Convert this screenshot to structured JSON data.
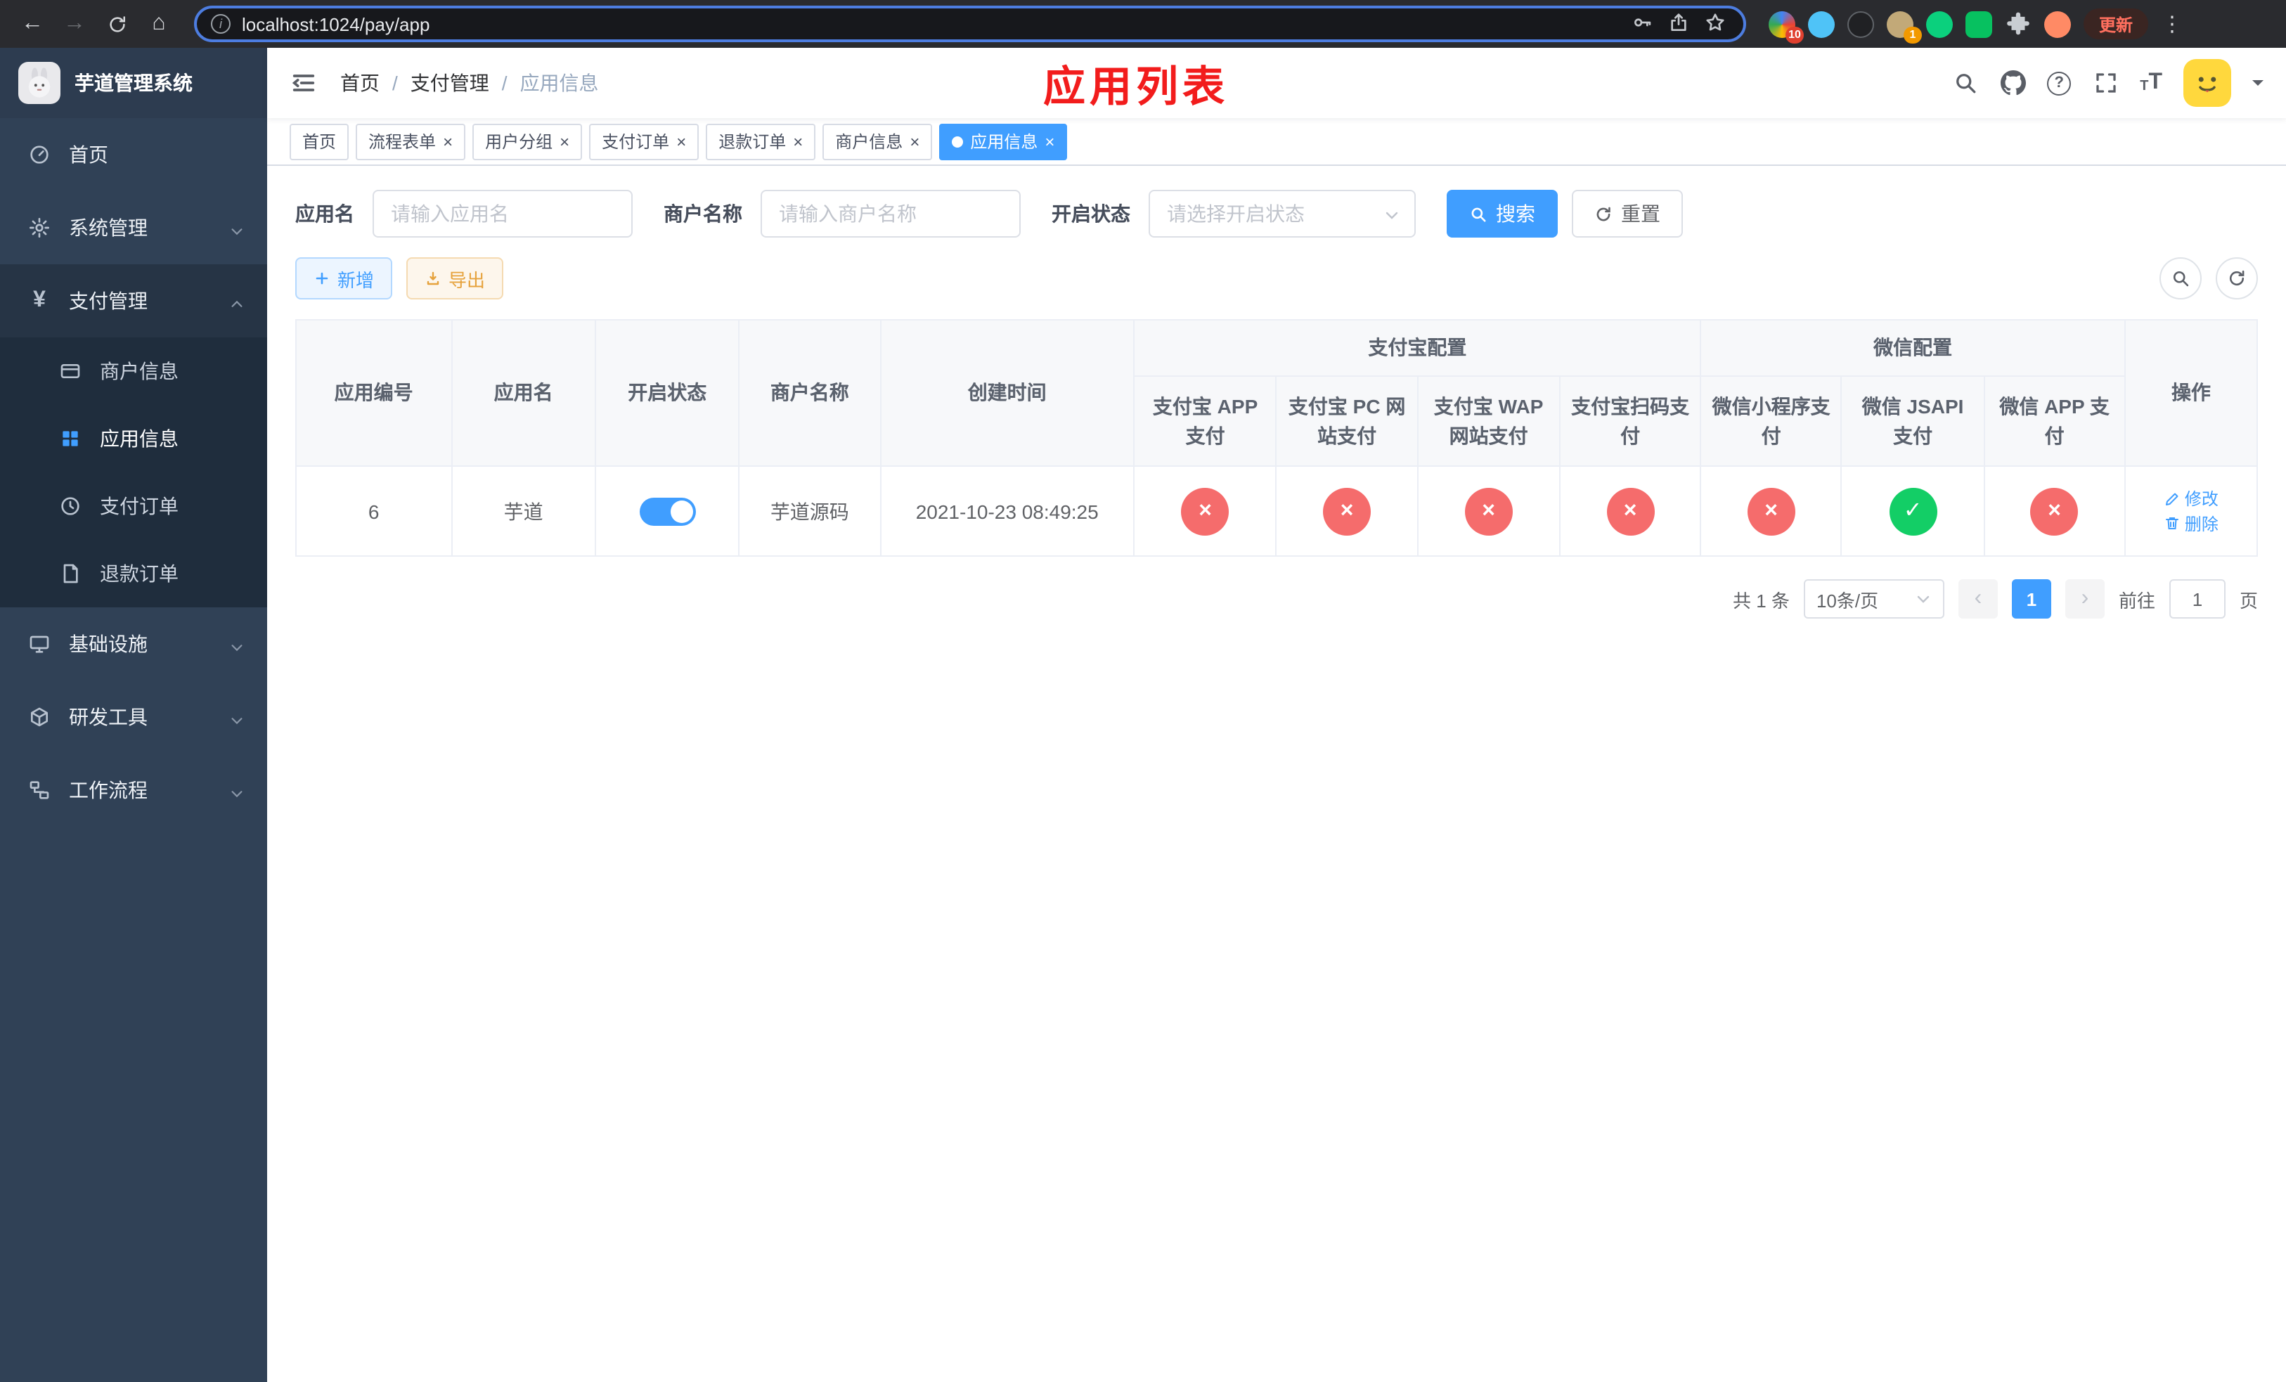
{
  "colors": {
    "accent": "#409eff",
    "success": "#13ce66",
    "danger": "#f56c6c",
    "warning": "#e6a23c",
    "annotation": "#f21c1c"
  },
  "ui": {
    "close_glyph": "×",
    "check_glyph": "✓",
    "cross_glyph": "×"
  },
  "browser": {
    "url": "localhost:1024/pay/app",
    "update_label": "更新",
    "ext_badge_puzzle": "10",
    "ext_badge_profile": "1"
  },
  "sidebar": {
    "logo_title": "芋道管理系统",
    "items": [
      {
        "label": "首页"
      },
      {
        "label": "系统管理"
      },
      {
        "label": "支付管理",
        "children": [
          {
            "label": "商户信息"
          },
          {
            "label": "应用信息"
          },
          {
            "label": "支付订单"
          },
          {
            "label": "退款订单"
          }
        ]
      },
      {
        "label": "基础设施"
      },
      {
        "label": "研发工具"
      },
      {
        "label": "工作流程"
      }
    ]
  },
  "navbar": {
    "breadcrumb": [
      "首页",
      "支付管理",
      "应用信息"
    ],
    "separator": "/",
    "annotation": "应用列表"
  },
  "tabs": [
    {
      "label": "首页"
    },
    {
      "label": "流程表单"
    },
    {
      "label": "用户分组"
    },
    {
      "label": "支付订单"
    },
    {
      "label": "退款订单"
    },
    {
      "label": "商户信息"
    },
    {
      "label": "应用信息"
    }
  ],
  "filters": {
    "app_name_label": "应用名",
    "app_name_placeholder": "请输入应用名",
    "merchant_label": "商户名称",
    "merchant_placeholder": "请输入商户名称",
    "status_label": "开启状态",
    "status_placeholder": "请选择开启状态",
    "search_label": "搜索",
    "reset_label": "重置"
  },
  "toolbar": {
    "add_label": "新增",
    "export_label": "导出"
  },
  "table": {
    "group_alipay": "支付宝配置",
    "group_wechat": "微信配置",
    "columns": [
      "应用编号",
      "应用名",
      "开启状态",
      "商户名称",
      "创建时间",
      "支付宝 APP 支付",
      "支付宝 PC 网站支付",
      "支付宝 WAP 网站支付",
      "支付宝扫码支付",
      "微信小程序支付",
      "微信 JSAPI 支付",
      "微信 APP 支付",
      "操作"
    ],
    "rows": [
      {
        "app_id": "6",
        "app_name": "芋道",
        "enabled": true,
        "merchant_name": "芋道源码",
        "create_time": "2021-10-23 08:49:25",
        "statuses": [
          false,
          false,
          false,
          false,
          false,
          true,
          false
        ],
        "edit_label": "修改",
        "delete_label": "删除"
      }
    ]
  },
  "pagination": {
    "total_text": "共 1 条",
    "page_size_text": "10条/页",
    "prev_glyph": "‹",
    "next_glyph": "›",
    "current_page": "1",
    "goto_prefix": "前往",
    "goto_value": "1",
    "goto_suffix": "页"
  }
}
